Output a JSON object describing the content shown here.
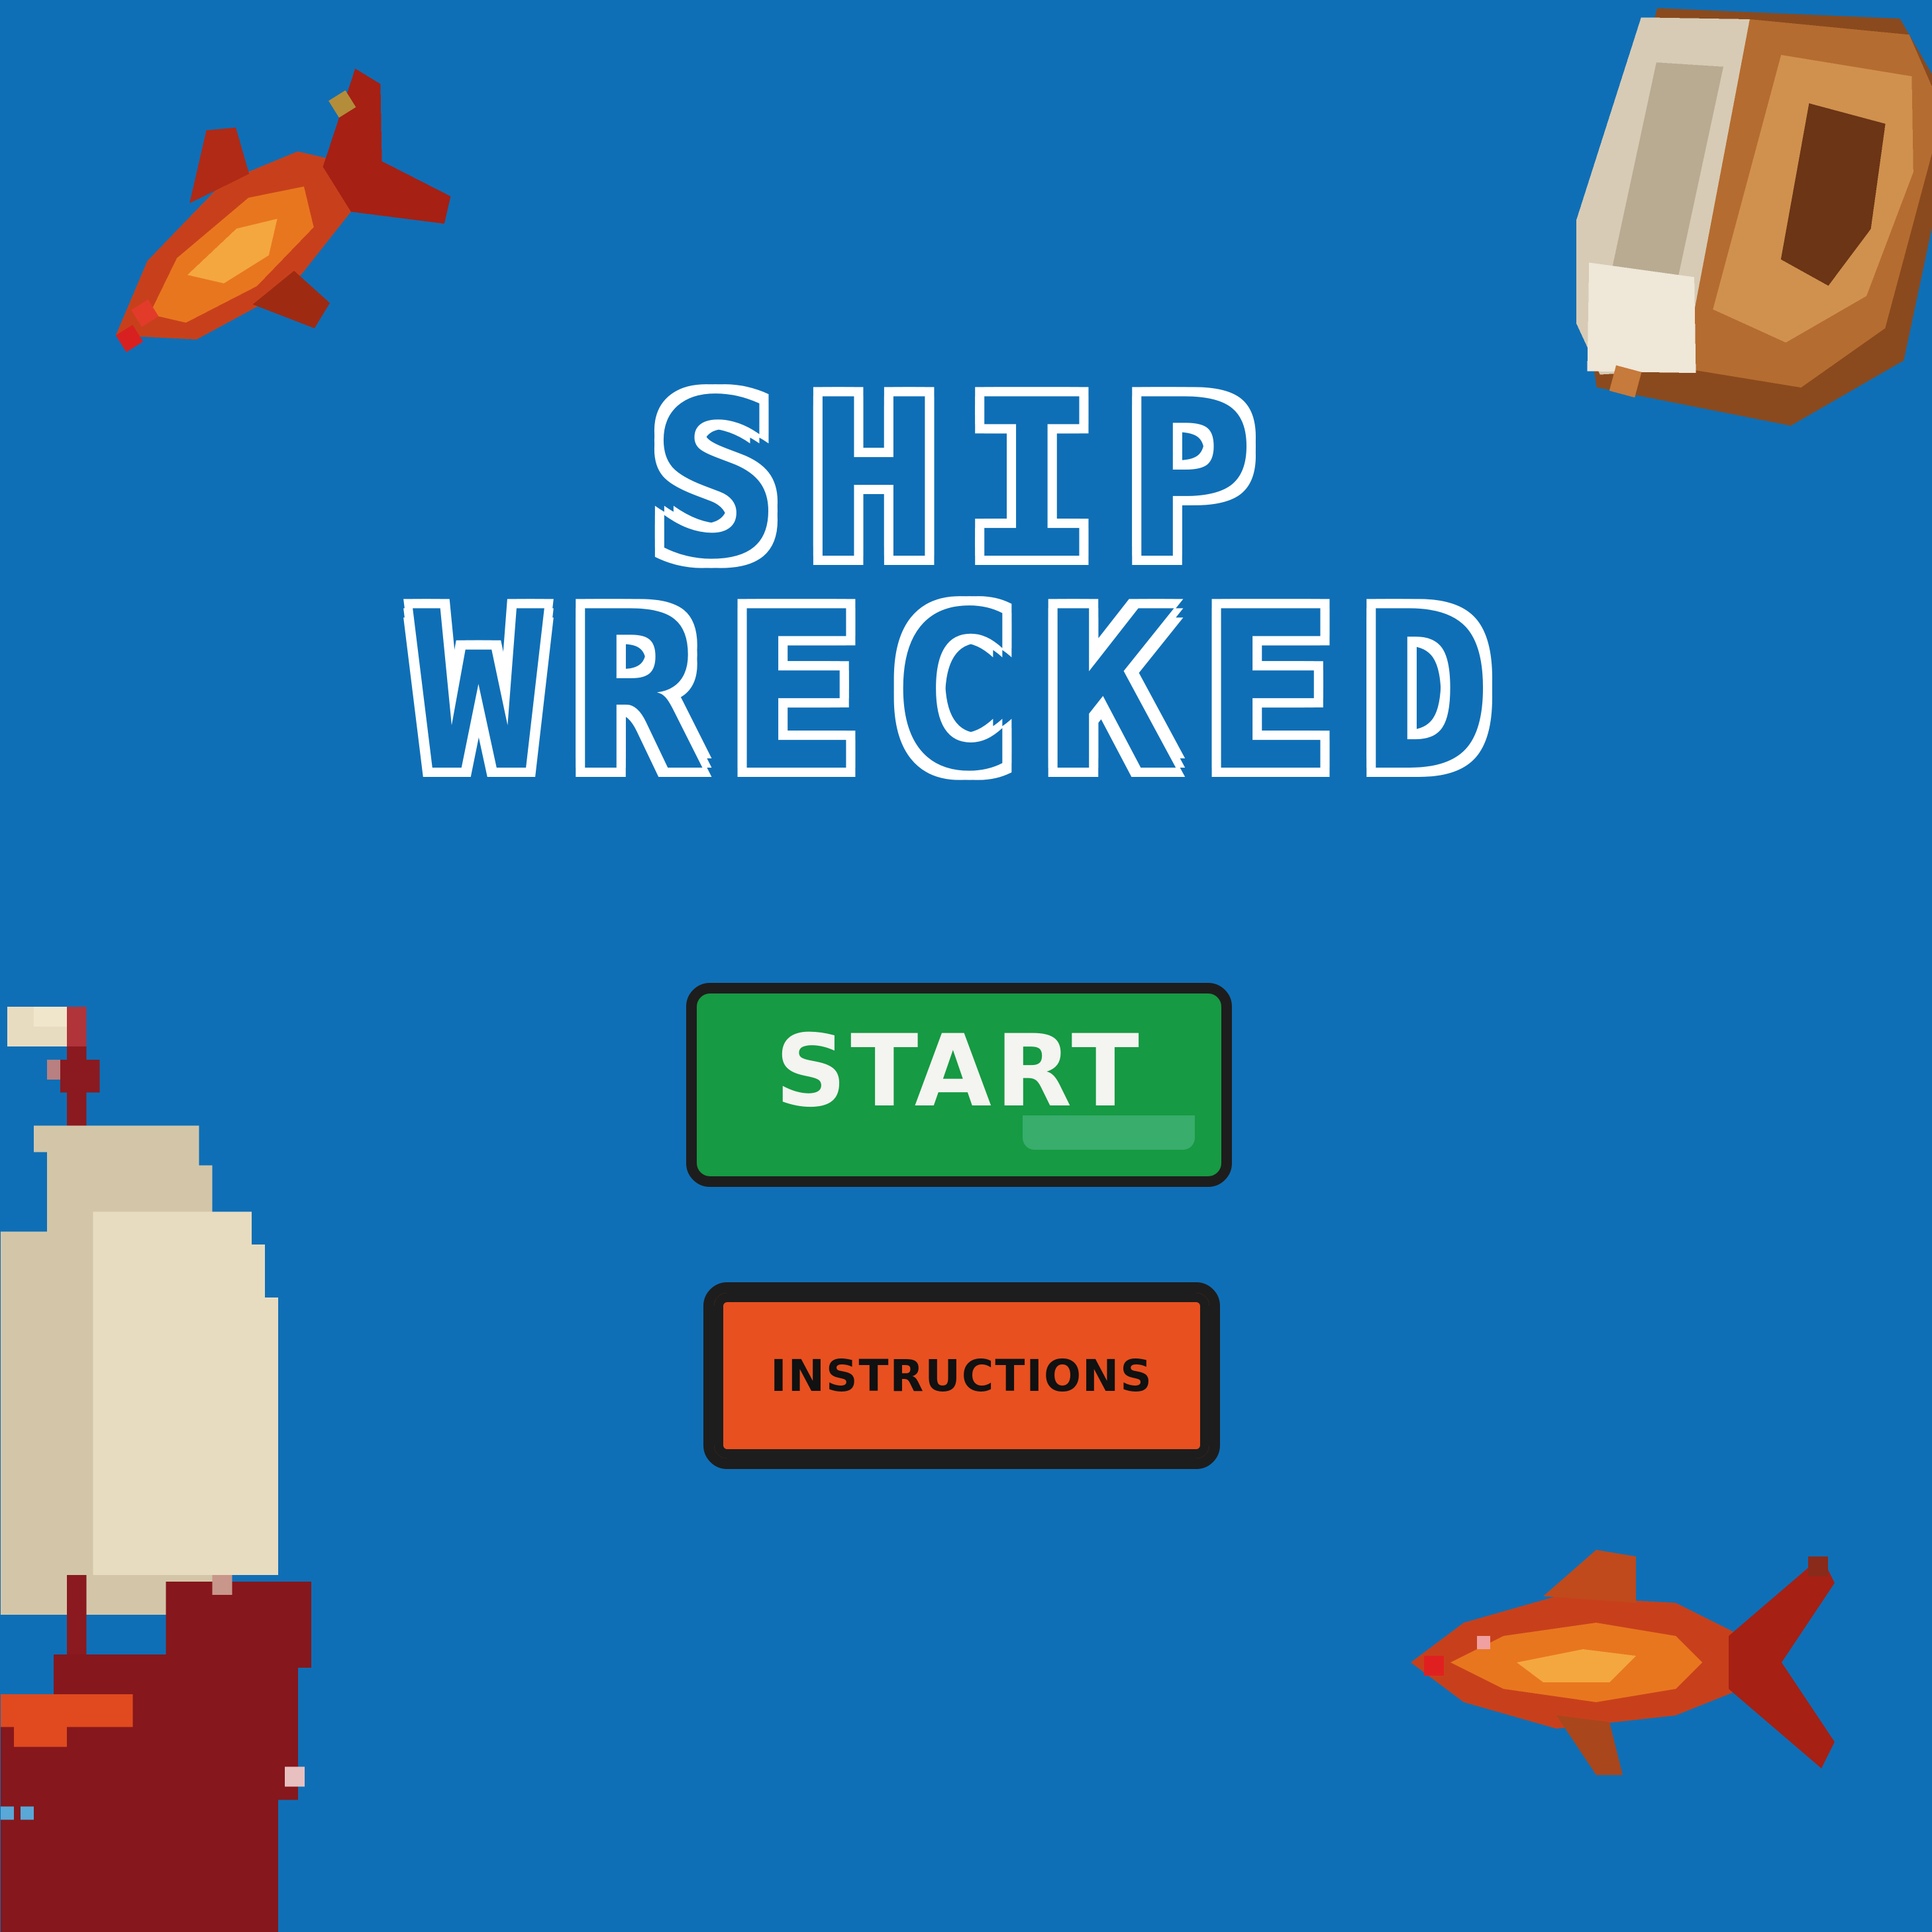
{
  "title": {
    "line1": "SHIP",
    "line2": "WRECKED"
  },
  "buttons": {
    "start_label": "START",
    "instructions_label": "INSTRUCTIONS"
  },
  "colors": {
    "background": "#0f6fb6",
    "start_button": "#169a43",
    "instructions_button": "#e8501f",
    "button_border": "#1d1d1d",
    "title_fill": "#ffffff"
  },
  "icons": {
    "fish_top_left": "orange-fish-icon",
    "fish_bottom_right": "goldfish-icon",
    "bread": "bread-loaf-icon",
    "ship": "pirate-ship-icon"
  }
}
